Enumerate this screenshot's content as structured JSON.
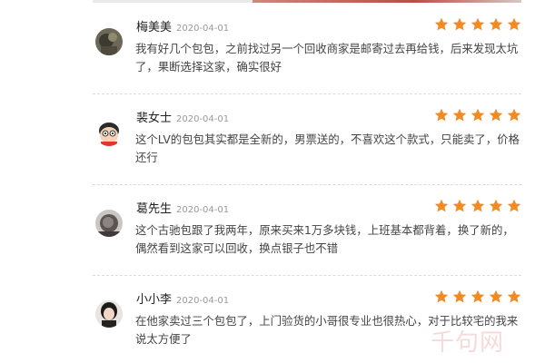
{
  "reviews": [
    {
      "name": "梅美美",
      "date": "2020-04-01",
      "rating": 5,
      "comment": "我有好几个包包，之前找过另一个回收商家是邮寄过去再给钱，后来发现太坑了，果断选择这家，确实很好"
    },
    {
      "name": "裴女士",
      "date": "2020-04-01",
      "rating": 5,
      "comment": "这个LV的包包其实都是全新的，男票送的，不喜欢这个款式，只能卖了，价格还行"
    },
    {
      "name": "葛先生",
      "date": "2020-04-01",
      "rating": 5,
      "comment": "这个古驰包跟了我两年，原来买来1万多块钱，上班基本都背着，换了新的，偶然看到这家可以回收，换点银子也不错"
    },
    {
      "name": "小小李",
      "date": "2020-04-01",
      "rating": 5,
      "comment": "在他家卖过三个包包了，上门验货的小哥很专业也很热心，对于比较宅的我来说太方便了"
    }
  ],
  "colors": {
    "star": "#f08a24",
    "name": "#222222",
    "date": "#999999",
    "comment": "#444444"
  },
  "icons": {
    "rating": "star-icon"
  },
  "watermark": "千句网"
}
